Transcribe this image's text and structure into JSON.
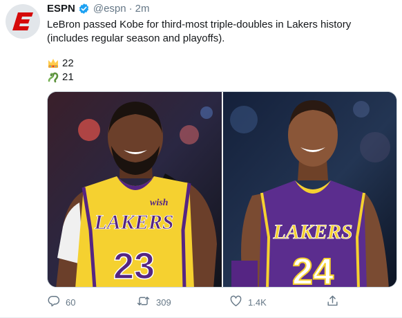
{
  "tweet": {
    "author_name": "ESPN",
    "handle": "@espn",
    "separator": "·",
    "time": "2m",
    "text": "LeBron passed Kobe for third-most triple-doubles in Lakers history (includes regular season and playoffs).",
    "stats": [
      {
        "icon": "crown-icon",
        "value": "22"
      },
      {
        "icon": "snake-icon",
        "value": "21"
      }
    ],
    "image": {
      "left_jersey_brand": "LAKERS",
      "left_jersey_number": "23",
      "left_jersey_patch": "wish",
      "right_jersey_brand": "LAKERS",
      "right_jersey_number": "24"
    },
    "actions": {
      "reply_count": "60",
      "retweet_count": "309",
      "like_count": "1.4K"
    }
  },
  "colors": {
    "espn_red": "#d50a0a",
    "verified_blue": "#1da1f2",
    "muted_text": "#657786",
    "lakers_gold": "#f5d130",
    "lakers_purple": "#552583"
  }
}
